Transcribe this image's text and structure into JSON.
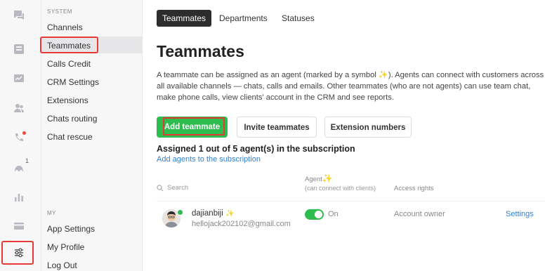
{
  "rail": {
    "icons": [
      "chat-icon",
      "inbox-icon",
      "reports-icon",
      "contacts-icon",
      "phone-icon",
      "tasks-icon",
      "stats-icon",
      "card-icon",
      "settings-sliders-icon"
    ],
    "tasks_badge": "1",
    "accent_dot_color": "#e74c3c"
  },
  "sidebar": {
    "section_system": "SYSTEM",
    "items": [
      "Channels",
      "Teammates",
      "Calls Credit",
      "CRM Settings",
      "Extensions",
      "Chats routing",
      "Chat rescue"
    ],
    "section_my": "MY",
    "my_items": [
      "App Settings",
      "My Profile",
      "Log Out"
    ],
    "active": "Teammates"
  },
  "tabs": [
    "Teammates",
    "Departments",
    "Statuses"
  ],
  "page": {
    "title": "Teammates",
    "description_part1": "A teammate can be assigned as an agent (marked by a symbol ",
    "description_sparkle": "✨",
    "description_part2": "). Agents can connect with customers across all available channels — chats, calls and emails. Other teammates (who are not agents) can use team chat, make phone calls, view clients' account in the CRM and see reports.",
    "buttons": {
      "add_teammate": "Add teammate",
      "invite_teammates": "Invite teammates",
      "extension_numbers": "Extension numbers"
    },
    "assigned_text": "Assigned 1 out of 5 agent(s) in the subscription",
    "add_agents_link": "Add agents to the subscription"
  },
  "table": {
    "search_placeholder": "Search",
    "agent_header": "Agent",
    "agent_sparkle": "✨",
    "agent_subheader": "(can connect with clients)",
    "access_header": "Access rights",
    "rows": [
      {
        "name": "dajianbiji",
        "sparkle": "✨",
        "email": "hellojack202102@gmail.com",
        "agent_state": "On",
        "access": "Account owner",
        "action": "Settings"
      }
    ]
  },
  "colors": {
    "primary_green": "#2ebc4f",
    "link_blue": "#2f80d1",
    "highlight_red": "#e53935",
    "dark_tab": "#2d2d2d"
  }
}
